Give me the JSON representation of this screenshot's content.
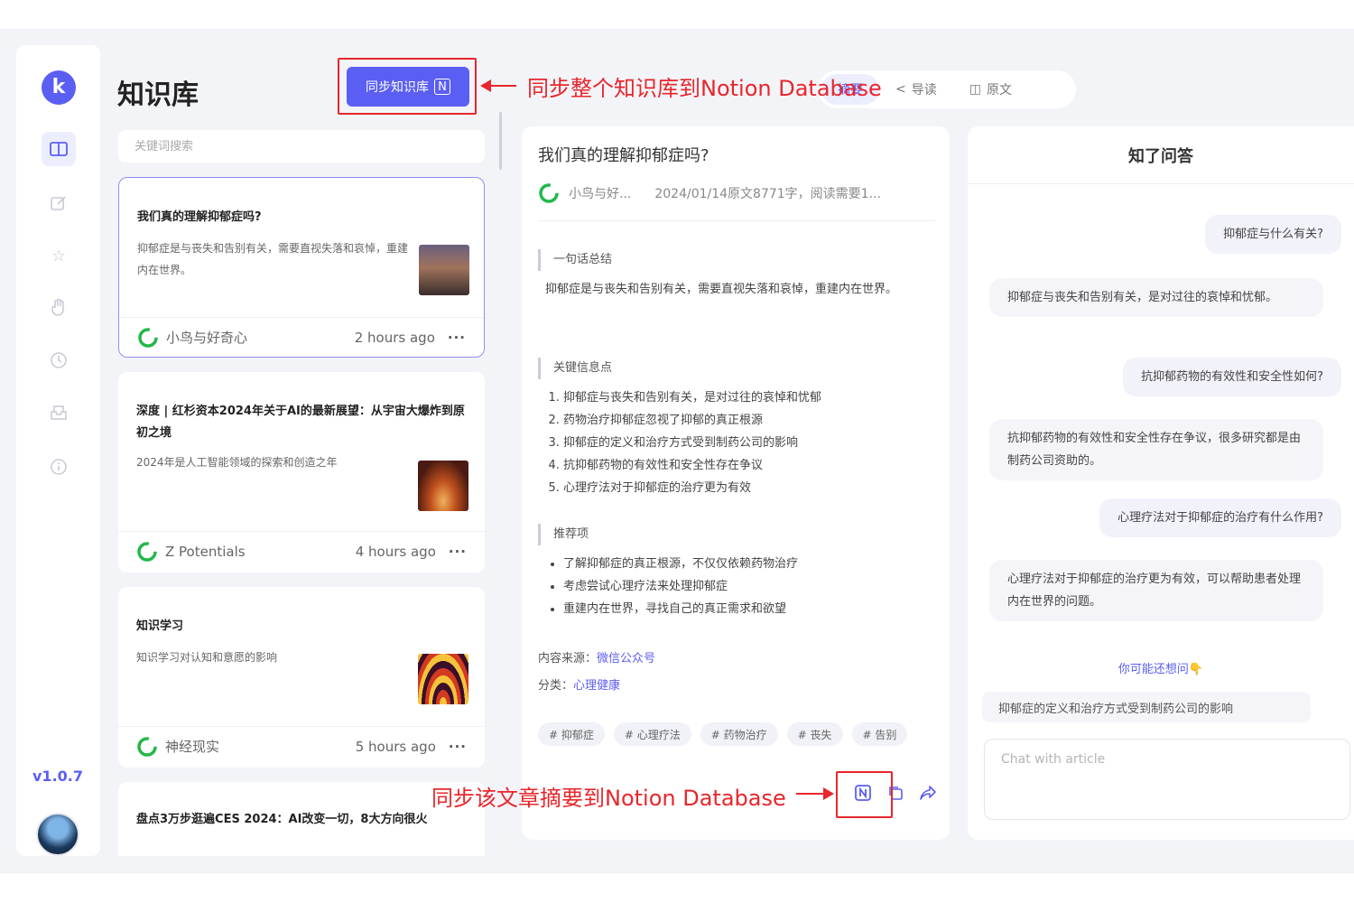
{
  "sidebar": {
    "logo": "k",
    "version": "v1.0.7",
    "icons": [
      "book-icon",
      "edit-icon",
      "star-icon",
      "hand-icon",
      "clock-icon",
      "inbox-icon",
      "info-icon"
    ]
  },
  "knowledge_base": {
    "title": "知识库",
    "sync_button_label": "同步知识库",
    "search_placeholder": "关键词搜索",
    "cards": [
      {
        "title": "我们真的理解抑郁症吗?",
        "summary": "抑郁症是与丧失和告别有关，需要直视失落和哀悼，重建内在世界。",
        "source": "小鸟与好奇心",
        "time": "2 hours ago",
        "more": "···"
      },
      {
        "title": "深度 | 红杉资本2024年关于AI的最新展望：从宇宙大爆炸到原初之境",
        "summary": "2024年是人工智能领域的探索和创造之年",
        "source": "Z Potentials",
        "time": "4 hours ago",
        "more": "···"
      },
      {
        "title": "知识学习",
        "summary": "知识学习对认知和意愿的影响",
        "source": "神经现实",
        "time": "5 hours ago",
        "more": "···"
      },
      {
        "title": "盘点3万步逛遍CES 2024：AI改变一切，8大方向很火",
        "summary": "",
        "source": "",
        "time": "",
        "more": ""
      }
    ]
  },
  "top_tabs": [
    {
      "label": "摘要",
      "icon": "summary-icon",
      "active": true
    },
    {
      "label": "导读",
      "icon": "share-icon",
      "active": false
    },
    {
      "label": "原文",
      "icon": "book-icon",
      "active": false
    }
  ],
  "article": {
    "title": "我们真的理解抑郁症吗?",
    "source": "小鸟与好...",
    "meta": "2024/01/14原文8771字，阅读需要1...",
    "sections": {
      "one_line_title": "一句话总结",
      "one_line_body": "抑郁症是与丧失和告别有关，需要直视失落和哀悼，重建内在世界。",
      "key_points_title": "关键信息点",
      "key_points": [
        "抑郁症与丧失和告别有关，是对过往的哀悼和忧郁",
        "药物治疗抑郁症忽视了抑郁的真正根源",
        "抑郁症的定义和治疗方式受到制药公司的影响",
        "抗抑郁药物的有效性和安全性存在争议",
        "心理疗法对于抑郁症的治疗更为有效"
      ],
      "recommend_title": "推荐项",
      "recommendations": [
        "了解抑郁症的真正根源，不仅仅依赖药物治疗",
        "考虑尝试心理疗法来处理抑郁症",
        "重建内在世界，寻找自己的真正需求和欲望"
      ]
    },
    "content_source_label": "内容来源：",
    "content_source_value": "微信公众号",
    "category_label": "分类：",
    "category_value": "心理健康",
    "tags": [
      "# 抑郁症",
      "# 心理疗法",
      "# 药物治疗",
      "# 丧失",
      "# 告别"
    ]
  },
  "qa": {
    "title": "知了问答",
    "messages": [
      {
        "role": "user",
        "text": "抑郁症与什么有关?"
      },
      {
        "role": "bot",
        "text": "抑郁症与丧失和告别有关，是对过往的哀悼和忧郁。"
      },
      {
        "role": "user",
        "text": "抗抑郁药物的有效性和安全性如何?"
      },
      {
        "role": "bot",
        "text": "抗抑郁药物的有效性和安全性存在争议，很多研究都是由制药公司资助的。"
      },
      {
        "role": "user",
        "text": "心理疗法对于抑郁症的治疗有什么作用?"
      },
      {
        "role": "bot",
        "text": "心理疗法对于抑郁症的治疗更为有效，可以帮助患者处理内在世界的问题。"
      }
    ],
    "suggest_title": "你可能还想问👇",
    "suggestion": "抑郁症的定义和治疗方式受到制药公司的影响",
    "input_placeholder": "Chat with article"
  },
  "annotations": {
    "top": "同步整个知识库到Notion Database",
    "bottom": "同步该文章摘要到Notion Database",
    "color": "#e8262c"
  },
  "colors": {
    "accent": "#5b5ef2",
    "background": "#f3f4f8"
  }
}
